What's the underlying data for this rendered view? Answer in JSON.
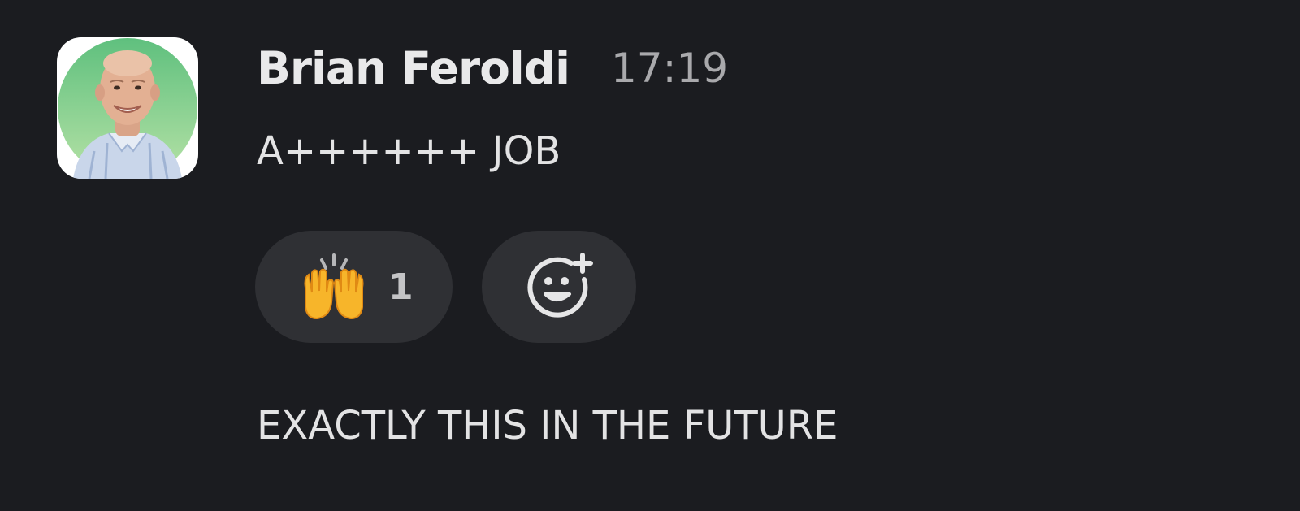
{
  "message": {
    "author": "Brian Feroldi",
    "timestamp": "17:19",
    "text_lines": [
      "A++++++ JOB",
      "EXACTLY THIS IN THE FUTURE"
    ],
    "avatar": {
      "icon": "user-avatar-photo",
      "accent_color": "#6cc58a"
    }
  },
  "reactions": [
    {
      "emoji": "raising-hands-emoji",
      "count": "1"
    }
  ],
  "add_reaction": {
    "icon": "add-reaction-smiley-icon"
  },
  "colors": {
    "background": "#1b1c20",
    "reaction_pill": "#2f3034",
    "author_text": "#e9e9ea",
    "timestamp_text": "#a9a9ac"
  }
}
